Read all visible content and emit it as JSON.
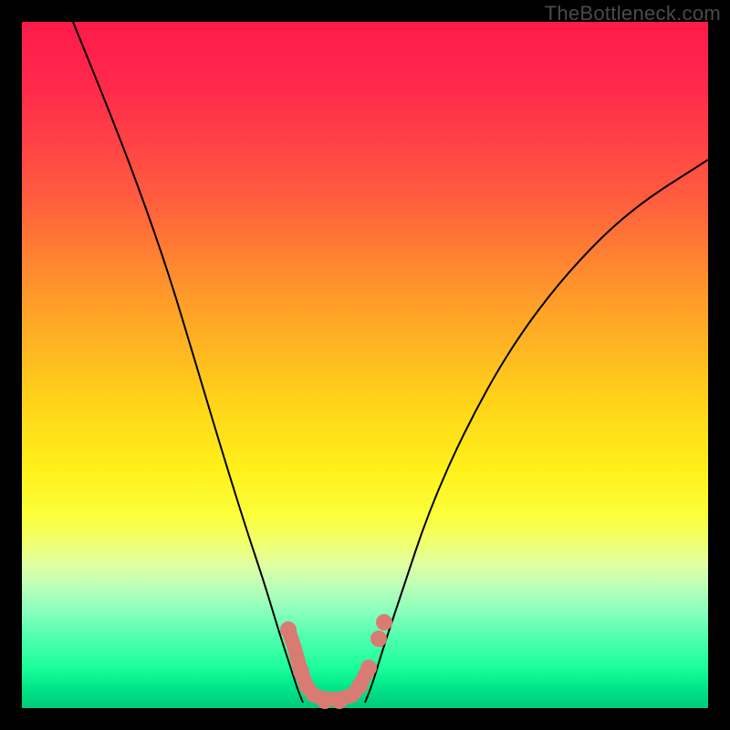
{
  "watermark": "TheBottleneck.com",
  "chart_data": {
    "type": "line",
    "title": "",
    "xlabel": "",
    "ylabel": "",
    "xlim": [
      24,
      776
    ],
    "ylim": [
      24,
      776
    ],
    "curves": {
      "left": [
        [
          80,
          24
        ],
        [
          115,
          110
        ],
        [
          150,
          200
        ],
        [
          185,
          300
        ],
        [
          215,
          400
        ],
        [
          245,
          500
        ],
        [
          270,
          580
        ],
        [
          290,
          640
        ],
        [
          305,
          690
        ],
        [
          318,
          730
        ],
        [
          326,
          755
        ],
        [
          332,
          770
        ]
      ],
      "right": [
        [
          400,
          770
        ],
        [
          408,
          750
        ],
        [
          420,
          710
        ],
        [
          440,
          650
        ],
        [
          470,
          560
        ],
        [
          510,
          470
        ],
        [
          560,
          380
        ],
        [
          620,
          300
        ],
        [
          690,
          230
        ],
        [
          776,
          175
        ]
      ]
    },
    "cluster_path": [
      [
        316,
        690
      ],
      [
        322,
        708
      ],
      [
        330,
        736
      ],
      [
        336,
        752
      ],
      [
        344,
        762
      ],
      [
        356,
        766
      ],
      [
        372,
        766
      ],
      [
        386,
        762
      ],
      [
        394,
        752
      ],
      [
        402,
        736
      ]
    ],
    "cluster_dots": [
      [
        316,
        690
      ],
      [
        330,
        736
      ],
      [
        356,
        768
      ],
      [
        372,
        768
      ],
      [
        394,
        752
      ],
      [
        404,
        732
      ],
      [
        415,
        700
      ],
      [
        421,
        682
      ]
    ],
    "colors": {
      "curve": "#000000",
      "cluster": "#d97b72"
    }
  }
}
